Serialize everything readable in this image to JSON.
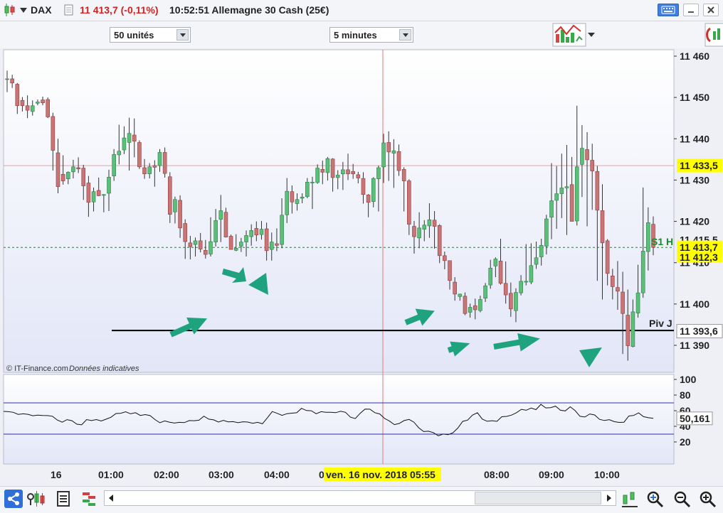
{
  "titlebar": {
    "instrument": "DAX",
    "price_change": "11 413,7 (-0,11%)",
    "time_and_name": "10:52:51 Allemagne 30 Cash (25€)"
  },
  "toolbar": {
    "units_select": "50 unités",
    "interval_select": "5 minutes"
  },
  "price_axis": {
    "ticks": [
      "11 460",
      "11 450",
      "11 440",
      "11 430",
      "11 420",
      "11 410",
      "11 400",
      "11 390"
    ],
    "tick_values": [
      11460,
      11450,
      11440,
      11430,
      11420,
      11410,
      11400,
      11390
    ],
    "crosshair_label": "11 433,5",
    "crosshair_value": 11433.5,
    "last_price_label": "11 413,7",
    "last_price_value": 11413.7,
    "s1h_label": "11 415,5",
    "s1h_value": 11415.5,
    "low_label": "11 412,3",
    "piv_label": "11 393,6",
    "piv_value": 11393.6
  },
  "annotations": {
    "s1h_text": "S1 H",
    "pivot_text": "Piv J",
    "copyright": "© IT-Finance.com",
    "disclaimer": "Données indicatives"
  },
  "oscillator": {
    "ticks": [
      "100",
      "80",
      "60",
      "40",
      "20"
    ],
    "tick_values": [
      100,
      80,
      60,
      40,
      20
    ],
    "upper_band": 70,
    "lower_band": 30,
    "value_label": "50,161",
    "value": 50.161
  },
  "time_axis": {
    "labels": [
      "16",
      "01:00",
      "02:00",
      "03:00",
      "04:00",
      "0",
      "08:00",
      "09:00",
      "10:00"
    ],
    "crosshair_date": "ven. 16 nov. 2018 05:55"
  },
  "colors": {
    "bull": "#5bbf7a",
    "bear": "#c97575",
    "arrow": "#1fa37f",
    "last_price": "#ffff00",
    "crosshair": "#e07a7a"
  },
  "chart_data": {
    "type": "candlestick",
    "timeframe": "5 minutes",
    "ylim": [
      11386,
      11462
    ],
    "candles_ohlc": [
      [
        11454.4,
        11456.5,
        11451.3,
        11454.5
      ],
      [
        11454.5,
        11455.5,
        11452.3,
        11453.5
      ],
      [
        11453.2,
        11453.5,
        11446.0,
        11448.0
      ],
      [
        11449.3,
        11450.1,
        11446.6,
        11448.0
      ],
      [
        11448.0,
        11450.5,
        11445.0,
        11446.9
      ],
      [
        11446.6,
        11449.3,
        11445.6,
        11448.0
      ],
      [
        11448.6,
        11449.5,
        11448.1,
        11448.9
      ],
      [
        11449.4,
        11450.2,
        11448.1,
        11448.7
      ],
      [
        11449.5,
        11450.0,
        11445.0,
        11445.3
      ],
      [
        11445.4,
        11446.3,
        11432.3,
        11437.2
      ],
      [
        11436.6,
        11440.0,
        11426.8,
        11428.4
      ],
      [
        11431.4,
        11436.0,
        11428.9,
        11429.8
      ],
      [
        11430.3,
        11432.1,
        11429.0,
        11431.9
      ],
      [
        11432.0,
        11434.9,
        11430.4,
        11433.2
      ],
      [
        11433.0,
        11435.5,
        11431.7,
        11432.7
      ],
      [
        11432.9,
        11433.7,
        11425.2,
        11428.6
      ],
      [
        11429.3,
        11431.0,
        11421.1,
        11424.6
      ],
      [
        11424.7,
        11428.2,
        11422.4,
        11427.2
      ],
      [
        11427.5,
        11430.6,
        11426.1,
        11426.2
      ],
      [
        11426.3,
        11426.6,
        11422.2,
        11426.5
      ],
      [
        11426.8,
        11432.5,
        11422.5,
        11430.7
      ],
      [
        11431.0,
        11437.5,
        11429.8,
        11436.2
      ],
      [
        11436.1,
        11443.4,
        11433.8,
        11437.0
      ],
      [
        11437.3,
        11443.0,
        11436.3,
        11440.2
      ],
      [
        11439.1,
        11445.1,
        11432.3,
        11441.3
      ],
      [
        11440.9,
        11444.9,
        11435.5,
        11439.4
      ],
      [
        11439.1,
        11439.6,
        11432.7,
        11433.2
      ],
      [
        11433.0,
        11435.1,
        11430.3,
        11431.5
      ],
      [
        11431.5,
        11434.1,
        11430.4,
        11433.2
      ],
      [
        11433.5,
        11434.8,
        11428.4,
        11433.1
      ],
      [
        11433.5,
        11437.5,
        11432.0,
        11436.7
      ],
      [
        11436.7,
        11437.9,
        11430.6,
        11431.6
      ],
      [
        11430.8,
        11431.9,
        11419.6,
        11421.7
      ],
      [
        11422.3,
        11426.0,
        11419.5,
        11425.3
      ],
      [
        11425.1,
        11426.3,
        11416.0,
        11418.4
      ],
      [
        11419.5,
        11420.5,
        11410.9,
        11415.1
      ],
      [
        11414.8,
        11416.5,
        11410.8,
        11413.9
      ],
      [
        11414.4,
        11416.1,
        11411.5,
        11415.3
      ],
      [
        11415.3,
        11417.2,
        11412.5,
        11413.3
      ],
      [
        11413.0,
        11415.5,
        11411.0,
        11412.0
      ],
      [
        11412.1,
        11421.0,
        11411.5,
        11415.1
      ],
      [
        11415.0,
        11423.0,
        11413.9,
        11420.2
      ],
      [
        11420.5,
        11426.4,
        11415.0,
        11422.6
      ],
      [
        11422.2,
        11423.3,
        11416.1,
        11416.2
      ],
      [
        11416.4,
        11416.8,
        11413.2,
        11413.2
      ],
      [
        11413.0,
        11416.9,
        11412.8,
        11413.5
      ],
      [
        11414.0,
        11416.0,
        11412.6,
        11415.0
      ],
      [
        11415.0,
        11417.8,
        11411.5,
        11416.6
      ],
      [
        11416.3,
        11419.3,
        11414.1,
        11417.8
      ],
      [
        11418.3,
        11420.0,
        11415.2,
        11416.7
      ],
      [
        11416.8,
        11420.1,
        11415.6,
        11418.1
      ],
      [
        11418.2,
        11419.7,
        11410.5,
        11412.9
      ],
      [
        11413.2,
        11417.3,
        11410.5,
        11415.0
      ],
      [
        11414.6,
        11418.3,
        11412.8,
        11414.2
      ],
      [
        11414.4,
        11425.6,
        11413.5,
        11421.5
      ],
      [
        11421.6,
        11430.5,
        11419.6,
        11427.3
      ],
      [
        11427.2,
        11428.7,
        11421.9,
        11424.7
      ],
      [
        11424.3,
        11426.8,
        11422.6,
        11425.3
      ],
      [
        11425.6,
        11426.8,
        11424.4,
        11425.9
      ],
      [
        11426.0,
        11430.5,
        11425.6,
        11429.5
      ],
      [
        11429.3,
        11430.8,
        11423.0,
        11429.5
      ],
      [
        11429.4,
        11433.8,
        11429.1,
        11432.9
      ],
      [
        11432.6,
        11434.7,
        11429.0,
        11431.9
      ],
      [
        11431.8,
        11435.6,
        11429.9,
        11435.2
      ],
      [
        11435.1,
        11435.3,
        11427.2,
        11430.6
      ],
      [
        11430.6,
        11432.4,
        11427.8,
        11431.2
      ],
      [
        11431.5,
        11434.4,
        11427.6,
        11432.5
      ],
      [
        11432.5,
        11436.4,
        11430.0,
        11431.5
      ],
      [
        11432.1,
        11433.9,
        11430.3,
        11431.5
      ],
      [
        11431.3,
        11432.0,
        11429.2,
        11430.5
      ],
      [
        11430.4,
        11431.9,
        11424.3,
        11426.5
      ],
      [
        11426.4,
        11426.6,
        11421.0,
        11424.6
      ],
      [
        11424.8,
        11430.7,
        11423.4,
        11430.4
      ],
      [
        11430.3,
        11433.5,
        11422.4,
        11433.0
      ],
      [
        11433.2,
        11441.2,
        11429.3,
        11439.0
      ],
      [
        11439.1,
        11441.8,
        11429.8,
        11436.8
      ],
      [
        11436.5,
        11439.9,
        11428.1,
        11437.1
      ],
      [
        11436.9,
        11438.6,
        11431.0,
        11432.3
      ],
      [
        11432.6,
        11433.1,
        11422.4,
        11429.8
      ],
      [
        11429.8,
        11430.2,
        11416.7,
        11419.3
      ],
      [
        11418.8,
        11420.1,
        11412.2,
        11416.3
      ],
      [
        11416.0,
        11422.2,
        11413.5,
        11418.4
      ],
      [
        11418.1,
        11420.3,
        11415.2,
        11419.1
      ],
      [
        11418.9,
        11424.4,
        11416.0,
        11420.4
      ],
      [
        11420.3,
        11422.5,
        11413.4,
        11418.8
      ],
      [
        11419.0,
        11419.3,
        11409.9,
        11411.7
      ],
      [
        11411.7,
        11412.7,
        11408.4,
        11410.5
      ],
      [
        11410.5,
        11410.5,
        11403.5,
        11405.7
      ],
      [
        11405.3,
        11406.5,
        11400.8,
        11402.4
      ],
      [
        11401.8,
        11402.5,
        11400.8,
        11402.4
      ],
      [
        11401.9,
        11402.8,
        11397.3,
        11397.7
      ],
      [
        11398.0,
        11400.1,
        11396.7,
        11399.2
      ],
      [
        11399.6,
        11401.3,
        11396.3,
        11398.6
      ],
      [
        11398.4,
        11402.0,
        11398.0,
        11401.1
      ],
      [
        11401.4,
        11405.1,
        11400.5,
        11404.4
      ],
      [
        11404.6,
        11410.7,
        11403.7,
        11408.7
      ],
      [
        11409.2,
        11411.3,
        11406.5,
        11410.9
      ],
      [
        11410.4,
        11415.8,
        11404.7,
        11405.0
      ],
      [
        11405.0,
        11410.3,
        11400.1,
        11402.2
      ],
      [
        11402.6,
        11405.2,
        11396.9,
        11398.8
      ],
      [
        11398.4,
        11403.8,
        11395.6,
        11402.8
      ],
      [
        11402.7,
        11407.0,
        11402.1,
        11405.5
      ],
      [
        11405.3,
        11414.5,
        11404.5,
        11405.5
      ],
      [
        11405.3,
        11414.7,
        11404.8,
        11409.3
      ],
      [
        11409.6,
        11415.1,
        11408.5,
        11411.2
      ],
      [
        11411.4,
        11415.8,
        11409.3,
        11414.2
      ],
      [
        11414.0,
        11421.6,
        11412.0,
        11420.6
      ],
      [
        11421.0,
        11434.1,
        11415.7,
        11425.0
      ],
      [
        11425.1,
        11433.4,
        11418.2,
        11426.7
      ],
      [
        11426.7,
        11436.4,
        11420.8,
        11428.1
      ],
      [
        11428.1,
        11438.5,
        11416.7,
        11428.4
      ],
      [
        11428.9,
        11435.6,
        11421.8,
        11420.0
      ],
      [
        11420.1,
        11448.0,
        11419.0,
        11433.2
      ],
      [
        11433.8,
        11443.3,
        11425.9,
        11437.7
      ],
      [
        11437.4,
        11441.6,
        11418.8,
        11434.9
      ],
      [
        11434.8,
        11438.8,
        11422.8,
        11432.2
      ],
      [
        11432.1,
        11433.4,
        11405.6,
        11422.7
      ],
      [
        11422.6,
        11429.0,
        11401.1,
        11414.8
      ],
      [
        11415.3,
        11415.7,
        11404.5,
        11407.4
      ],
      [
        11406.8,
        11408.5,
        11401.1,
        11404.2
      ],
      [
        11404.0,
        11410.4,
        11398.6,
        11403.1
      ],
      [
        11402.9,
        11407.8,
        11387.9,
        11397.7
      ],
      [
        11397.3,
        11403.5,
        11386.3,
        11389.9
      ],
      [
        11389.7,
        11401.1,
        11389.5,
        11398.1
      ],
      [
        11397.8,
        11409.5,
        11396.7,
        11402.7
      ],
      [
        11402.7,
        11428.2,
        11401.5,
        11412.8
      ],
      [
        11412.7,
        11423.4,
        11408.1,
        11419.7
      ],
      [
        11419.3,
        11421.2,
        11411.8,
        11413.7
      ]
    ],
    "oscillator_values": [
      59.1,
      58.7,
      57.9,
      55.3,
      56.0,
      55.4,
      53.5,
      54.3,
      53.9,
      53.7,
      52.9,
      48.1,
      45.3,
      48.5,
      47.2,
      42.7,
      41.9,
      48.6,
      47.4,
      48.6,
      46.8,
      49.2,
      51.6,
      56.4,
      56.7,
      58.6,
      56.0,
      57.5,
      53.9,
      55.0,
      53.7,
      48.6,
      44.5,
      46.9,
      45.3,
      44.2,
      45.1,
      44.7,
      47.4,
      47.2,
      47.8,
      53.0,
      49.2,
      48.3,
      45.5,
      47.6,
      45.7,
      46.0,
      44.6,
      45.8,
      45.5,
      43.9,
      45.1,
      43.3,
      50.8,
      58.9,
      56.6,
      54.0,
      56.2,
      56.8,
      57.4,
      63.0,
      60.2,
      59.9,
      56.1,
      58.7,
      58.0,
      57.9,
      57.5,
      59.3,
      57.9,
      51.7,
      49.9,
      56.6,
      62.0,
      61.9,
      57.5,
      55.8,
      50.1,
      46.7,
      42.2,
      43.6,
      47.4,
      48.8,
      45.4,
      38.1,
      33.3,
      33.7,
      31.9,
      27.9,
      30.1,
      29.4,
      31.7,
      37.8,
      46.4,
      47.9,
      54.4,
      57.4,
      49.3,
      46.5,
      47.2,
      46.4,
      52.3,
      52.7,
      54.4,
      57.5,
      61.7,
      60.5,
      63.4,
      61.4,
      68.1,
      63.5,
      63.9,
      65.8,
      60.5,
      59.7,
      65.0,
      60.1,
      52.8,
      51.9,
      55.8,
      54.5,
      48.9,
      47.5,
      48.5,
      46.0,
      45.0,
      45.3,
      53.2,
      53.9,
      57.2,
      52.4,
      51.0,
      50.2
    ]
  }
}
